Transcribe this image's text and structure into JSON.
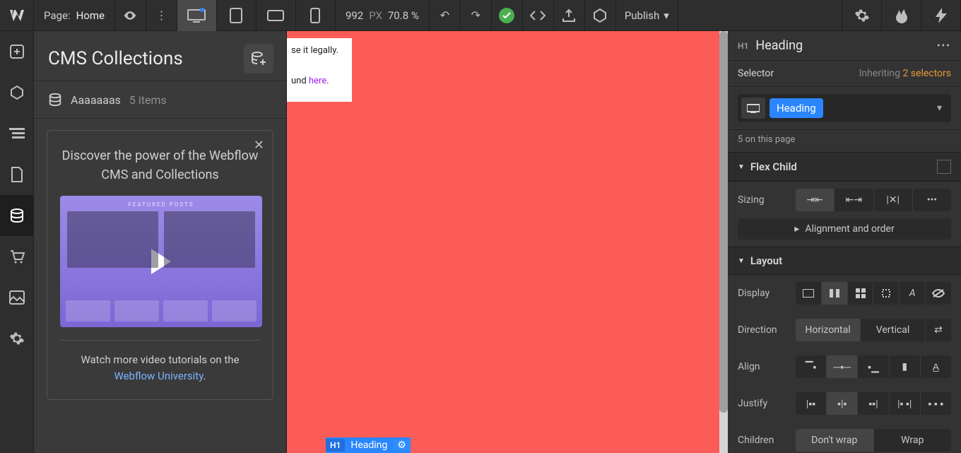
{
  "topbar": {
    "page_label_prefix": "Page:",
    "page_name": "Home",
    "canvas_width": "992",
    "px_unit": "PX",
    "zoom": "70.8 %",
    "publish_label": "Publish"
  },
  "cms": {
    "title": "CMS Collections",
    "collection": {
      "name": "Aaaaaaas",
      "count": "5 items"
    },
    "promo_title": "Discover the power of the Webflow CMS and Collections",
    "video_caption": "FEATURED POSTS",
    "footer_prefix": "Watch more video tutorials on the ",
    "footer_link": "Webflow University",
    "footer_suffix": "."
  },
  "canvas": {
    "legal_fragment": "se it legally.",
    "link_fragment_prefix": "und ",
    "link_text": "here",
    "link_suffix": ".",
    "selected_tag": "H1",
    "selected_label": "Heading"
  },
  "style": {
    "element_tag": "H1",
    "element_name": "Heading",
    "selector_label": "Selector",
    "inheriting_prefix": "Inheriting",
    "inheriting_count": "2 selectors",
    "class_name": "Heading",
    "on_page": "5 on this page",
    "sections": {
      "flex_child": "Flex Child",
      "layout": "Layout"
    },
    "props": {
      "sizing": "Sizing",
      "alignment_order": "Alignment and order",
      "display": "Display",
      "direction": "Direction",
      "dir_h": "Horizontal",
      "dir_v": "Vertical",
      "align": "Align",
      "justify": "Justify",
      "children": "Children",
      "wrap_dont": "Don't wrap",
      "wrap": "Wrap"
    }
  }
}
